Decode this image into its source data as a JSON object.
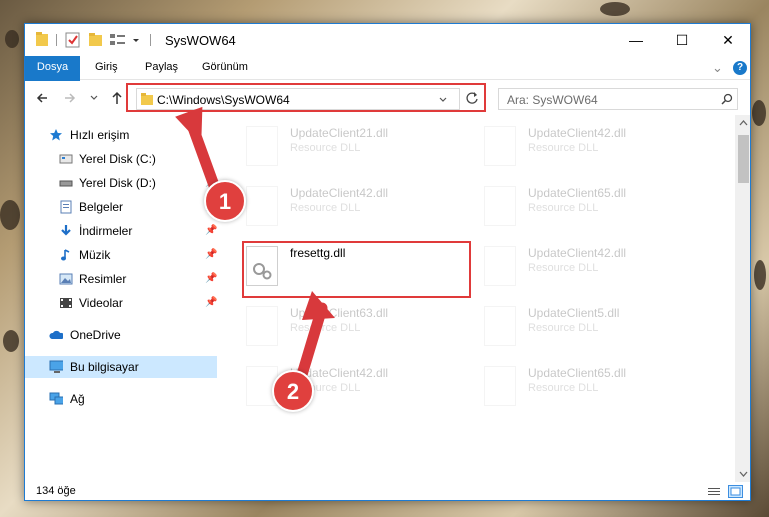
{
  "window": {
    "title": "SysWOW64",
    "controls": {
      "minimize": "—",
      "maximize": "☐",
      "close": "✕"
    }
  },
  "ribbon": {
    "tabs": [
      "Dosya",
      "Giriş",
      "Paylaş",
      "Görünüm"
    ],
    "expand_glyph": "⌄",
    "help_glyph": "?"
  },
  "navbar": {
    "path": "C:\\Windows\\SysWOW64",
    "search_placeholder": "Ara: SysWOW64"
  },
  "sidebar": {
    "quick_access": "Hızlı erişim",
    "items": [
      {
        "label": "Yerel Disk (C:)",
        "icon": "drive-icon"
      },
      {
        "label": "Yerel Disk (D:)",
        "icon": "drive-icon"
      },
      {
        "label": "Belgeler",
        "icon": "documents-icon"
      },
      {
        "label": "İndirmeler",
        "icon": "downloads-icon"
      },
      {
        "label": "Müzik",
        "icon": "music-icon"
      },
      {
        "label": "Resimler",
        "icon": "pictures-icon"
      },
      {
        "label": "Videolar",
        "icon": "videos-icon"
      }
    ],
    "onedrive": "OneDrive",
    "this_pc": "Bu bilgisayar",
    "network": "Ağ"
  },
  "files": [
    {
      "name": "UpdateClient21.dll",
      "type": "Resource DLL"
    },
    {
      "name": "UpdateClient42.dll",
      "type": "Resource DLL"
    },
    {
      "name": "UpdateClient42.dll",
      "type": "Resource DLL"
    },
    {
      "name": "UpdateClient65.dll",
      "type": "Resource DLL"
    },
    {
      "name": "fresettg.dll",
      "type": ""
    },
    {
      "name": "UpdateClient42.dll",
      "type": "Resource DLL"
    },
    {
      "name": "UpdateClient63.dll",
      "type": "Resource DLL"
    },
    {
      "name": "UpdateClient5.dll",
      "type": "Resource DLL"
    },
    {
      "name": "UpdateClient42.dll",
      "type": "Resource DLL"
    },
    {
      "name": "UpdateClient65.dll",
      "type": "Resource DLL"
    }
  ],
  "status": {
    "count": "134 öğe"
  },
  "annotations": {
    "step1": "1",
    "step2": "2"
  },
  "colors": {
    "accent": "#1979ca",
    "highlight": "#e03a3a",
    "selected": "#cce8ff"
  }
}
